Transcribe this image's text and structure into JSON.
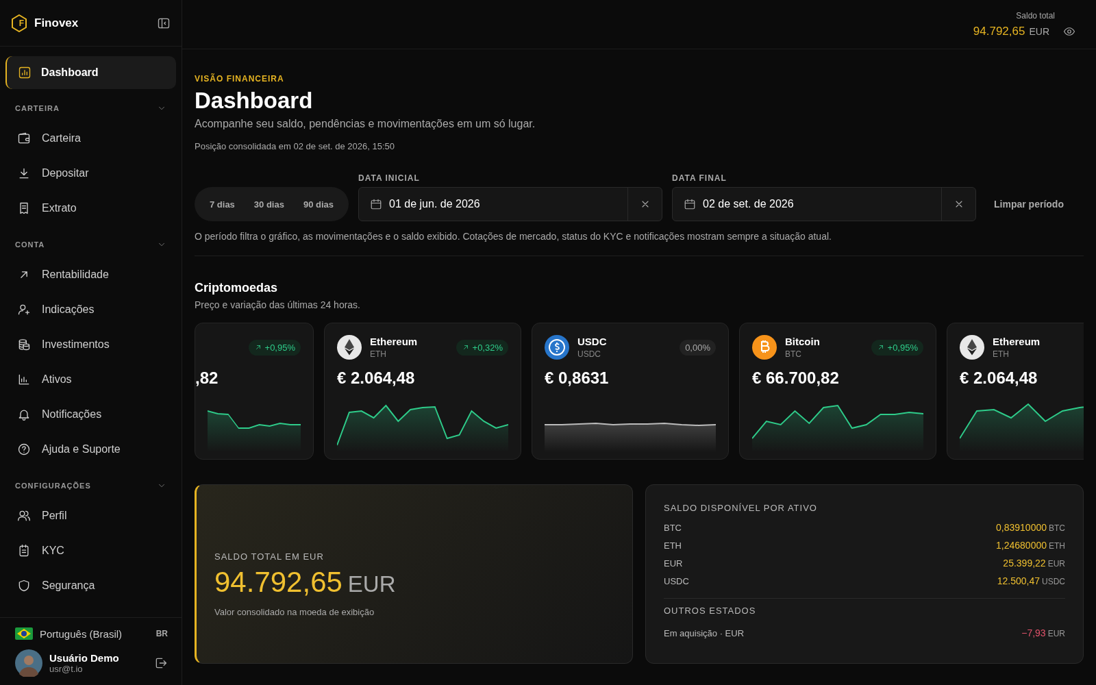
{
  "brand": {
    "name": "Finovex",
    "logo_letter": "F"
  },
  "sidebar": {
    "active": {
      "label": "Dashboard",
      "selected": true
    },
    "sections": [
      {
        "title": "CARTEIRA",
        "expanded": true,
        "items": [
          {
            "label": "Carteira"
          },
          {
            "label": "Depositar"
          },
          {
            "label": "Extrato"
          }
        ]
      },
      {
        "title": "CONTA",
        "expanded": true,
        "items": [
          {
            "label": "Rentabilidade"
          },
          {
            "label": "Indicações"
          },
          {
            "label": "Investimentos"
          },
          {
            "label": "Ativos"
          },
          {
            "label": "Notificações"
          },
          {
            "label": "Ajuda e Suporte"
          }
        ]
      },
      {
        "title": "CONFIGURAÇÕES",
        "expanded": true,
        "items": [
          {
            "label": "Perfil"
          },
          {
            "label": "KYC"
          },
          {
            "label": "Segurança"
          }
        ]
      }
    ],
    "language": {
      "label": "Português (Brasil)",
      "code": "BR"
    },
    "user": {
      "name": "Usuário Demo",
      "email": "usr@t.io"
    }
  },
  "topbar": {
    "label": "Saldo total",
    "amount": "94.792,65",
    "currency": "EUR"
  },
  "header": {
    "eyebrow": "VISÃO FINANCEIRA",
    "title": "Dashboard",
    "subtitle": "Acompanhe seu saldo, pendências e movimentações em um só lugar.",
    "position": "Posição consolidada em 02 de set. de 2026, 15:50"
  },
  "period": {
    "presets": [
      {
        "label": "7 dias",
        "selected": false
      },
      {
        "label": "30 dias",
        "selected": false
      },
      {
        "label": "90 dias",
        "selected": false
      }
    ],
    "start": {
      "label": "DATA INICIAL",
      "value": "01 de jun. de 2026"
    },
    "end": {
      "label": "DATA FINAL",
      "value": "02 de set. de 2026"
    },
    "clear": "Limpar período",
    "note": "O período filtra o gráfico, as movimentações e o saldo exibido. Cotações de mercado, status do KYC e notificações mostram sempre a situação atual."
  },
  "crypto": {
    "title": "Criptomoedas",
    "subtitle": "Preço e variação das últimas 24 horas.",
    "cards": [
      {
        "kind": "partial",
        "change": "+0,95%",
        "up": true,
        "price": ",82"
      },
      {
        "kind": "ethereum",
        "name": "Ethereum",
        "symbol": "ETH",
        "change": "+0,32%",
        "up": true,
        "price": "€ 2.064,48"
      },
      {
        "kind": "usdc",
        "name": "USDC",
        "symbol": "USDC",
        "change": "0,00%",
        "up": false,
        "price": "€ 0,8631"
      },
      {
        "kind": "bitcoin",
        "name": "Bitcoin",
        "symbol": "BTC",
        "change": "+0,95%",
        "up": true,
        "price": "€ 66.700,82"
      },
      {
        "kind": "ethereum",
        "name": "Ethereum",
        "symbol": "ETH",
        "up": true,
        "price": "€ 2.064,48"
      }
    ]
  },
  "total": {
    "label": "SALDO TOTAL EM EUR",
    "amount": "94.792,65",
    "currency": "EUR",
    "note": "Valor consolidado na moeda de exibição"
  },
  "balances": {
    "title": "SALDO DISPONÍVEL POR ATIVO",
    "rows": [
      {
        "asset": "BTC",
        "amount": "0,83910000",
        "unit": "BTC"
      },
      {
        "asset": "ETH",
        "amount": "1,24680000",
        "unit": "ETH"
      },
      {
        "asset": "EUR",
        "amount": "25.399,22",
        "unit": "EUR"
      },
      {
        "asset": "USDC",
        "amount": "12.500,47",
        "unit": "USDC"
      }
    ],
    "other_title": "OUTROS ESTADOS",
    "other_rows": [
      {
        "label": "Em aquisição · EUR",
        "amount": "−7,93",
        "unit": "EUR",
        "negative": true
      }
    ]
  }
}
